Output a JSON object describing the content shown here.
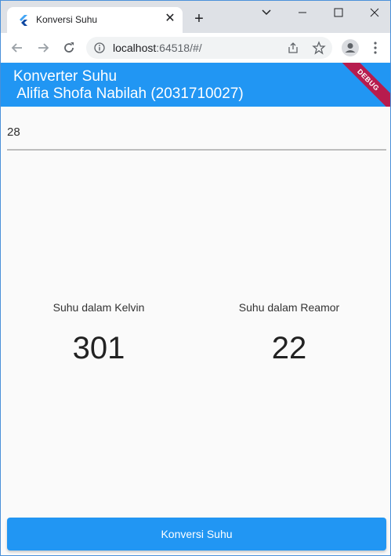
{
  "browser": {
    "tab_title": "Konversi Suhu",
    "url_host": "localhost",
    "url_rest": ":64518/#/"
  },
  "app": {
    "title": "Konverter Suhu\n Alifia Shofa Nabilah (2031710027)",
    "debug_banner": "DEBUG",
    "input_value": "28",
    "kelvin_label": "Suhu dalam Kelvin",
    "kelvin_value": "301",
    "reamur_label": "Suhu dalam Reamor",
    "reamur_value": "22",
    "button_label": "Konversi Suhu"
  },
  "colors": {
    "primary": "#2196f3",
    "debug": "#b71c4e"
  }
}
